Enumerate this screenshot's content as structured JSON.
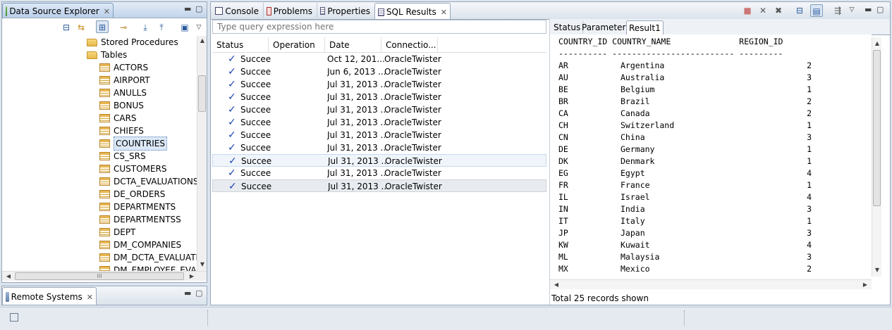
{
  "data_source_explorer": {
    "tab_label": "Data Source Explorer",
    "tree": [
      {
        "label": "Stored Procedures",
        "kind": "folder"
      },
      {
        "label": "Tables",
        "kind": "folder"
      },
      {
        "label": "ACTORS",
        "kind": "table"
      },
      {
        "label": "AIRPORT",
        "kind": "table"
      },
      {
        "label": "ANULLS",
        "kind": "table"
      },
      {
        "label": "BONUS",
        "kind": "table"
      },
      {
        "label": "CARS",
        "kind": "table"
      },
      {
        "label": "CHIEFS",
        "kind": "table"
      },
      {
        "label": "COUNTRIES",
        "kind": "table",
        "selected": true
      },
      {
        "label": "CS_SRS",
        "kind": "table"
      },
      {
        "label": "CUSTOMERS",
        "kind": "table"
      },
      {
        "label": "DCTA_EVALUATIONS",
        "kind": "table"
      },
      {
        "label": "DE_ORDERS",
        "kind": "table"
      },
      {
        "label": "DEPARTMENTS",
        "kind": "table"
      },
      {
        "label": "DEPARTMENTSS",
        "kind": "table"
      },
      {
        "label": "DEPT",
        "kind": "table"
      },
      {
        "label": "DM_COMPANIES",
        "kind": "table"
      },
      {
        "label": "DM_DCTA_EVALUATI",
        "kind": "table"
      },
      {
        "label": "DM_EMPLOYEE_EVAL",
        "kind": "table"
      }
    ],
    "hscroll_grip": "III"
  },
  "remote_systems": {
    "tab_label": "Remote Systems"
  },
  "console_tabs": [
    {
      "label": "Console"
    },
    {
      "label": "Problems"
    },
    {
      "label": "Properties"
    },
    {
      "label": "SQL Results",
      "active": true
    }
  ],
  "sql_results": {
    "filter_placeholder": "Type query expression here",
    "columns": [
      "Status",
      "Operation",
      "Date",
      "Connectio..."
    ],
    "rows": [
      {
        "status": "Succee",
        "operation": "",
        "date": "Oct 12, 201...",
        "connection": "OracleTwister"
      },
      {
        "status": "Succee",
        "operation": "",
        "date": "Jun 6, 2013 ...",
        "connection": "OracleTwister"
      },
      {
        "status": "Succee",
        "operation": "",
        "date": "Jul 31, 2013 ...",
        "connection": "OracleTwister"
      },
      {
        "status": "Succee",
        "operation": "",
        "date": "Jul 31, 2013 ...",
        "connection": "OracleTwister"
      },
      {
        "status": "Succee",
        "operation": "",
        "date": "Jul 31, 2013 ...",
        "connection": "OracleTwister"
      },
      {
        "status": "Succee",
        "operation": "",
        "date": "Jul 31, 2013 ...",
        "connection": "OracleTwister"
      },
      {
        "status": "Succee",
        "operation": "",
        "date": "Jul 31, 2013 ...",
        "connection": "OracleTwister"
      },
      {
        "status": "Succee",
        "operation": "",
        "date": "Jul 31, 2013 ...",
        "connection": "OracleTwister"
      },
      {
        "status": "Succee",
        "operation": "",
        "date": "Jul 31, 2013 ...",
        "connection": "OracleTwister",
        "state": "highlighted"
      },
      {
        "status": "Succee",
        "operation": "",
        "date": "Jul 31, 2013 ...",
        "connection": "OracleTwister"
      },
      {
        "status": "Succee",
        "operation": "",
        "date": "Jul 31, 2013 ...",
        "connection": "OracleTwister",
        "state": "selected"
      }
    ]
  },
  "result_tabs": [
    {
      "label": "Status"
    },
    {
      "label": "Parameters"
    },
    {
      "label": "Result1",
      "active": true
    }
  ],
  "result1": {
    "header": "COUNTRY_ID COUNTRY_NAME              REGION_ID",
    "separator": "---------- ------------------------- ---------",
    "rows": [
      {
        "id": "AR",
        "name": "Argentina",
        "region": "2"
      },
      {
        "id": "AU",
        "name": "Australia",
        "region": "3"
      },
      {
        "id": "BE",
        "name": "Belgium",
        "region": "1"
      },
      {
        "id": "BR",
        "name": "Brazil",
        "region": "2"
      },
      {
        "id": "CA",
        "name": "Canada",
        "region": "2"
      },
      {
        "id": "CH",
        "name": "Switzerland",
        "region": "1"
      },
      {
        "id": "CN",
        "name": "China",
        "region": "3"
      },
      {
        "id": "DE",
        "name": "Germany",
        "region": "1"
      },
      {
        "id": "DK",
        "name": "Denmark",
        "region": "1"
      },
      {
        "id": "EG",
        "name": "Egypt",
        "region": "4"
      },
      {
        "id": "FR",
        "name": "France",
        "region": "1"
      },
      {
        "id": "IL",
        "name": "Israel",
        "region": "4"
      },
      {
        "id": "IN",
        "name": "India",
        "region": "3"
      },
      {
        "id": "IT",
        "name": "Italy",
        "region": "1"
      },
      {
        "id": "JP",
        "name": "Japan",
        "region": "3"
      },
      {
        "id": "KW",
        "name": "Kuwait",
        "region": "4"
      },
      {
        "id": "ML",
        "name": "Malaysia",
        "region": "3"
      },
      {
        "id": "MX",
        "name": "Mexico",
        "region": "2"
      }
    ],
    "footer": "Total 25 records shown"
  },
  "icons": {
    "explorer_toolbar": [
      "collapse-all-icon",
      "link-editor-icon",
      "flat-layout-icon",
      "connect-icon",
      "import-icon",
      "export-icon",
      "save-icon",
      "view-menu-icon"
    ],
    "console_toolbar": [
      "stop-icon",
      "remove-icon",
      "remove-all-icon",
      "layout-icon",
      "text-mode-icon",
      "pin-icon",
      "view-menu-icon"
    ]
  },
  "colors": {
    "accent": "#1b44b6",
    "panel_border": "#99a8bc",
    "selection": "#dbe8f7"
  }
}
